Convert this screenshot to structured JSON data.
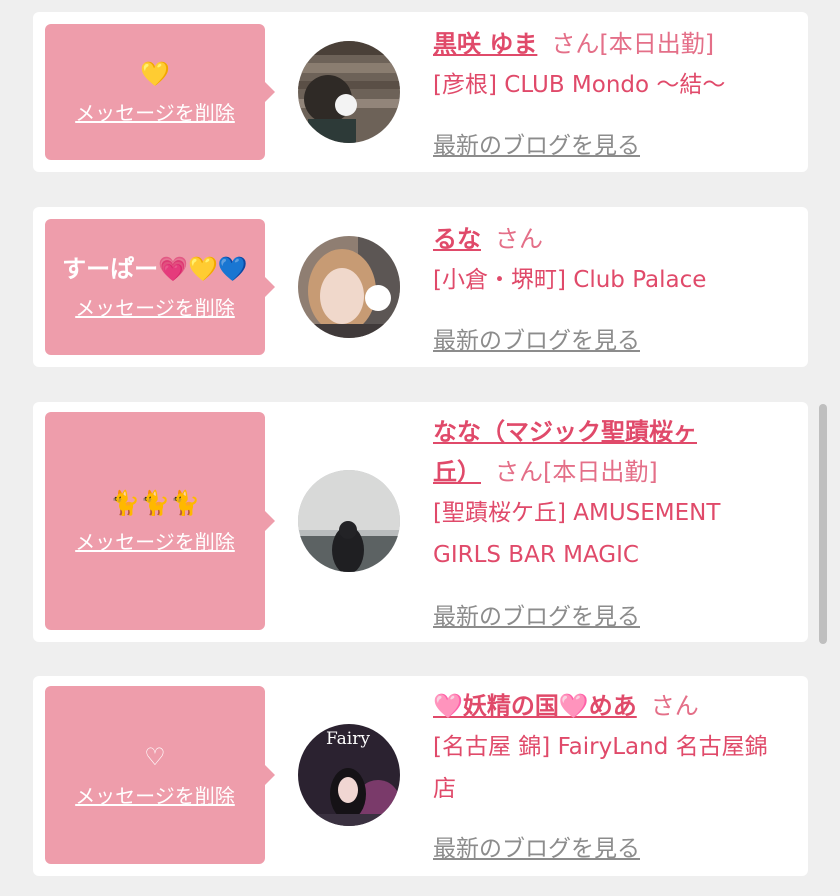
{
  "cards": [
    {
      "message": "💛",
      "delete_label": "メッセージを削除",
      "name": "黒咲 ゆま",
      "suffix": "さん[本日出勤]",
      "shop": "[彦根] CLUB Mondo 〜結〜",
      "blog": "最新のブログを見る"
    },
    {
      "message": "すーぱー💗💛💙",
      "delete_label": "メッセージを削除",
      "name": "るな",
      "suffix": "さん",
      "shop": "[小倉・堺町] Club Palace",
      "blog": "最新のブログを見る"
    },
    {
      "message": "🐈🐈🐈",
      "delete_label": "メッセージを削除",
      "name_line1": "なな（マジック聖蹟桜ヶ",
      "name_line2": "丘）",
      "suffix": "さん[本日出勤]",
      "shop_line1": "[聖蹟桜ケ丘] AMUSEMENT",
      "shop_line2": "GIRLS BAR MAGIC",
      "blog": "最新のブログを見る"
    },
    {
      "message": "♡",
      "delete_label": "メッセージを削除",
      "name": "🩷妖精の国🩷めあ",
      "suffix": "さん",
      "shop_line1": "[名古屋 錦] FairyLand 名古屋錦",
      "shop_line2": "店",
      "blog": "最新のブログを見る",
      "avatar_text": "Fairy"
    }
  ],
  "colors": {
    "accent": "#e04a6a",
    "message_box": "#ee9dab",
    "background": "#efefef"
  }
}
